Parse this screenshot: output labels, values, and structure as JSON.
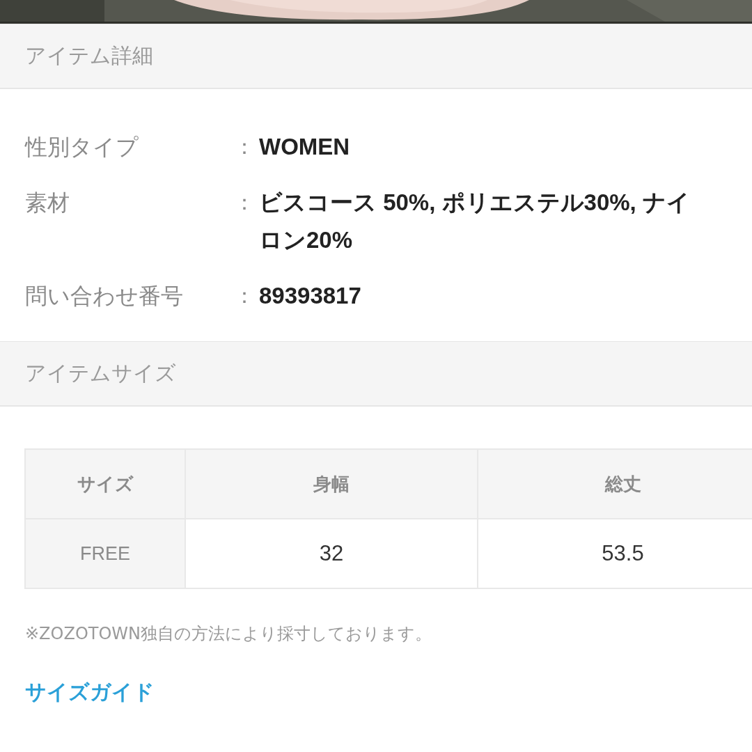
{
  "details_header": "アイテム詳細",
  "details": [
    {
      "label": "性別タイプ",
      "separator": "：",
      "lines": [
        "WOMEN"
      ]
    },
    {
      "label": "素材",
      "separator": "：",
      "lines": [
        "ビスコース 50%, ポリエステル30%, ナイ",
        "ロン20%"
      ]
    },
    {
      "label": "問い合わせ番号",
      "separator": "：",
      "lines": [
        "89393817"
      ]
    }
  ],
  "size_header": "アイテムサイズ",
  "size_table": {
    "columns": [
      "サイズ",
      "身幅",
      "総丈"
    ],
    "rows": [
      [
        "FREE",
        "32",
        "53.5"
      ]
    ]
  },
  "note": "※ZOZOTOWN独自の方法により採寸しております。",
  "size_guide_link": "サイズガイド"
}
